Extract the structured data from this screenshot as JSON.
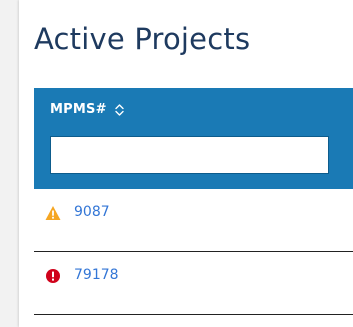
{
  "page": {
    "title": "Active Projects"
  },
  "table": {
    "column_label": "MPMS#",
    "sort_icon": "sort-up-down-icon",
    "filter_value": "",
    "filter_placeholder": "",
    "header_color": "#1a7ab5",
    "rows": [
      {
        "status_icon": "warning-triangle-icon",
        "status_color": "#f5a623",
        "value": "9087"
      },
      {
        "status_icon": "error-circle-icon",
        "status_color": "#d0021b",
        "value": "79178"
      }
    ]
  }
}
